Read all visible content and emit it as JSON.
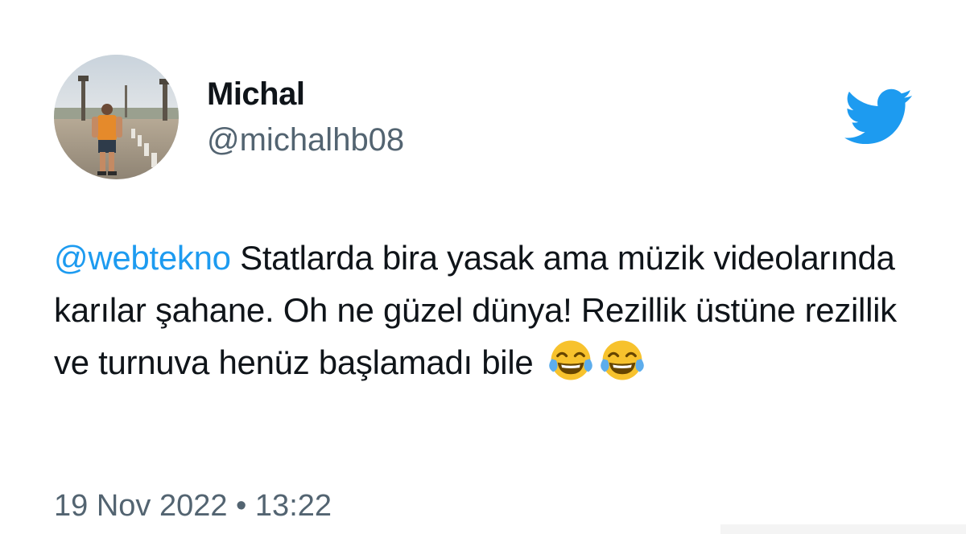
{
  "author": {
    "name": "Michal",
    "handle": "@michalhb08"
  },
  "tweet": {
    "mention": "@webtekno",
    "text": " Statlarda bira yasak ama müzik videolarında karılar şahane. Oh ne güzel dünya! Rezillik üstüne rezillik ve turnuva henüz başlamadı bile",
    "emojis": [
      "face-with-tears-of-joy-icon",
      "face-with-tears-of-joy-icon"
    ]
  },
  "meta": {
    "date": "19 Nov 2022",
    "separator": " • ",
    "time": "13:22"
  },
  "colors": {
    "twitter_blue": "#1d9bf0",
    "text": "#0f1419",
    "secondary": "#536471"
  }
}
